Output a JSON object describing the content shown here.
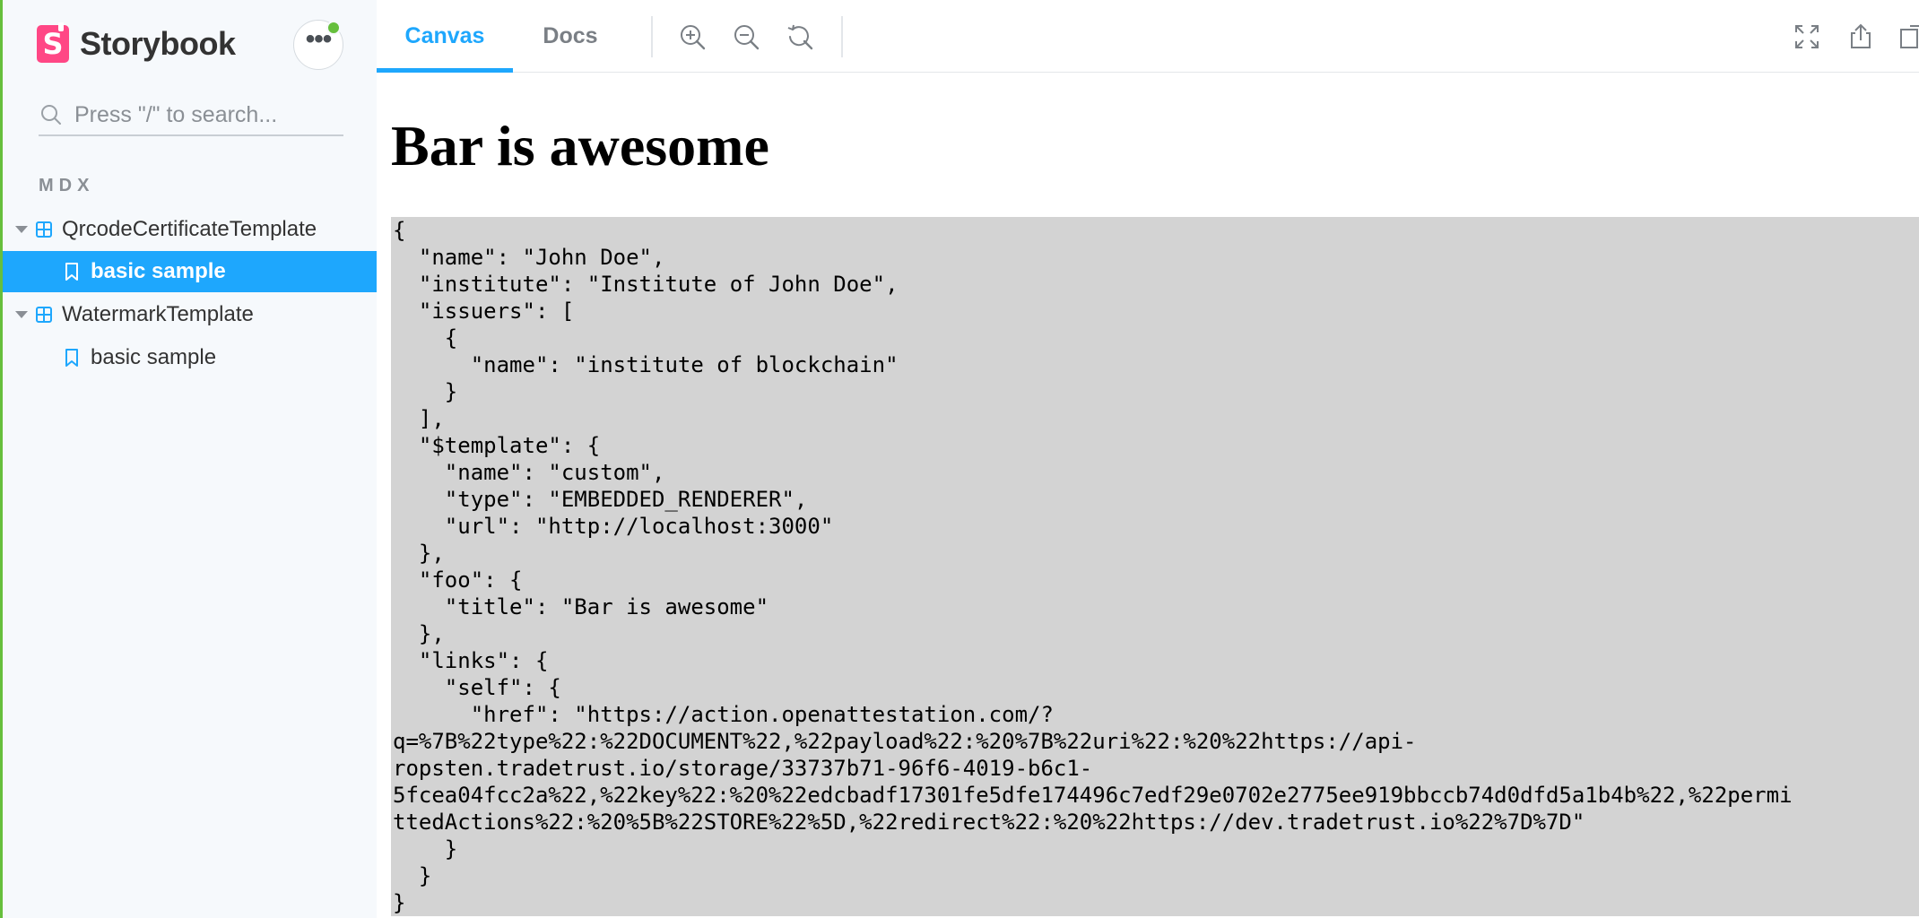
{
  "sidebar": {
    "brand": {
      "logo_letter": "S",
      "name": "Storybook"
    },
    "menu": {
      "label": "•••",
      "status_color": "#66bf3c"
    },
    "search": {
      "placeholder": "Press \"/\" to search..."
    },
    "section_label": "MDX",
    "tree": [
      {
        "type": "component",
        "label": "QrcodeCertificateTemplate",
        "expanded": true
      },
      {
        "type": "story",
        "label": "basic sample",
        "selected": true
      },
      {
        "type": "component",
        "label": "WatermarkTemplate",
        "expanded": true
      },
      {
        "type": "story",
        "label": "basic sample",
        "selected": false
      }
    ]
  },
  "toolbar": {
    "tabs": [
      {
        "label": "Canvas",
        "active": true
      },
      {
        "label": "Docs",
        "active": false
      }
    ],
    "tools": [
      "zoom-in-icon",
      "zoom-out-icon",
      "zoom-reset-icon"
    ],
    "right_tools": [
      "fullscreen-icon",
      "share-icon",
      "open-new-tab-icon"
    ]
  },
  "canvas": {
    "title": "Bar is awesome",
    "json_text": "{\n  \"name\": \"John Doe\",\n  \"institute\": \"Institute of John Doe\",\n  \"issuers\": [\n    {\n      \"name\": \"institute of blockchain\"\n    }\n  ],\n  \"$template\": {\n    \"name\": \"custom\",\n    \"type\": \"EMBEDDED_RENDERER\",\n    \"url\": \"http://localhost:3000\"\n  },\n  \"foo\": {\n    \"title\": \"Bar is awesome\"\n  },\n  \"links\": {\n    \"self\": {\n      \"href\": \"https://action.openattestation.com/?\nq=%7B%22type%22:%22DOCUMENT%22,%22payload%22:%20%7B%22uri%22:%20%22https://api-\nropsten.tradetrust.io/storage/33737b71-96f6-4019-b6c1-\n5fcea04fcc2a%22,%22key%22:%20%22edcbadf17301fe5dfe174496c7edf29e0702e2775ee919bbccb74d0dfd5a1b4b%22,%22permi\nttedActions%22:%20%5B%22STORE%22%5D,%22redirect%22:%20%22https://dev.tradetrust.io%22%7D%7D\"\n    }\n  }\n}"
  },
  "colors": {
    "accent": "#1ea7fd",
    "brand": "#ff4785",
    "sidebar_bg": "#f6f9fc",
    "code_bg": "#d3d3d3"
  }
}
